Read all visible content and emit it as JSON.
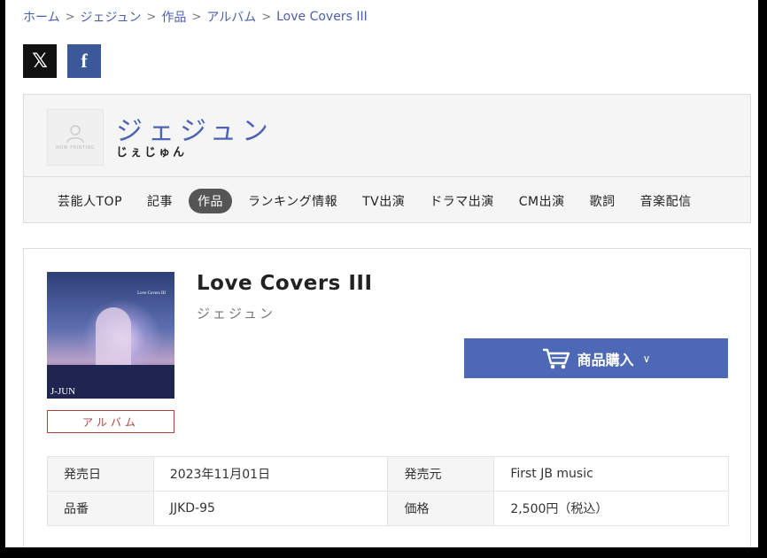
{
  "breadcrumb": [
    "ホーム",
    "ジェジュン",
    "作品",
    "アルバム",
    "Love Covers III"
  ],
  "social": {
    "x_label": "𝕏",
    "facebook_label": "f"
  },
  "artist": {
    "name": "ジェジュン",
    "kana": "じぇじゅん",
    "avatar_caption": "NOW PRINTING"
  },
  "nav": [
    "芸能人TOP",
    "記事",
    "作品",
    "ランキング情報",
    "TV出演",
    "ドラマ出演",
    "CM出演",
    "歌詞",
    "音楽配信"
  ],
  "nav_active": "作品",
  "product": {
    "title": "Love Covers III",
    "artist": "ジェジュン",
    "cover_tag": "J-JUN",
    "cover_small_title": "Love Covers III",
    "type_badge": "アルバム",
    "buy_label": "商品購入",
    "details": {
      "release_date_label": "発売日",
      "release_date": "2023年11月01日",
      "label_label": "発売元",
      "label": "First JB music",
      "catalog_label": "品番",
      "catalog": "JJKD-95",
      "price_label": "価格",
      "price": "2,500円（税込）"
    }
  },
  "colors": {
    "accent": "#4d69b6",
    "badge": "#b04040",
    "nav_active_bg": "#555555"
  }
}
